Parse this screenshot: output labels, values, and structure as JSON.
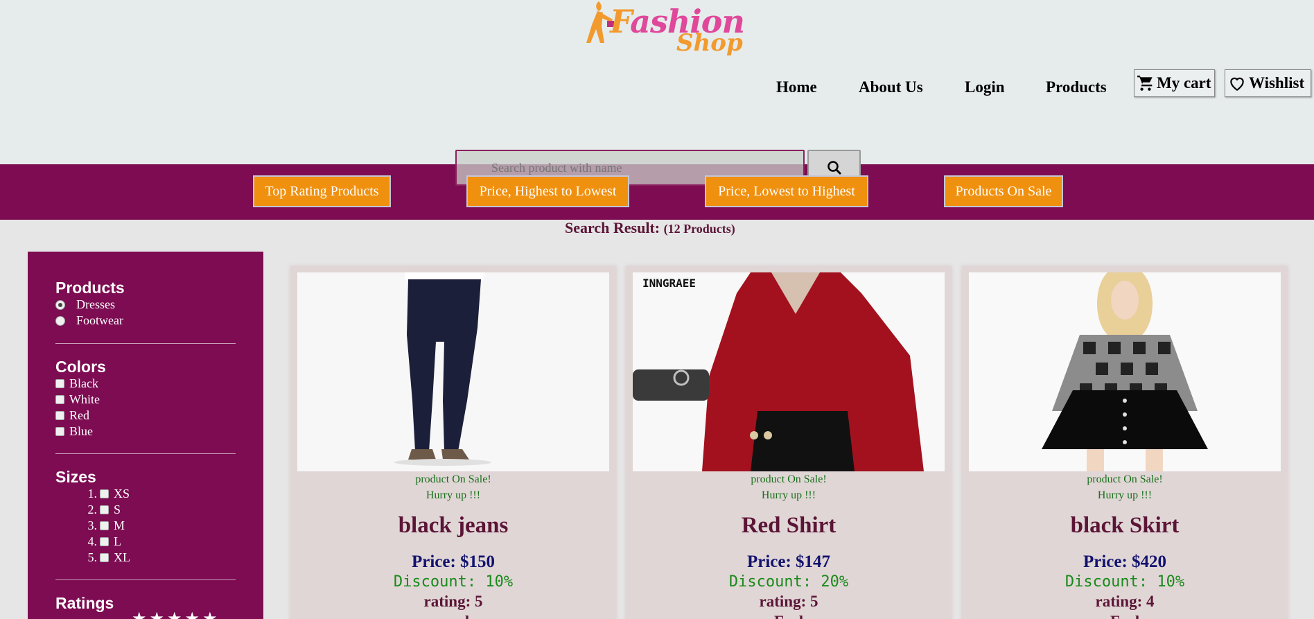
{
  "brand": {
    "logo_main": "ashion",
    "logo_f": "F",
    "logo_sub": "Shop"
  },
  "nav": {
    "home": "Home",
    "about": "About Us",
    "login": "Login",
    "products": "Products",
    "cart": "My cart",
    "wishlist": "Wishlist"
  },
  "search": {
    "placeholder": "Search product with name",
    "button_icon": "search-icon"
  },
  "sort_buttons": [
    "Top Rating Products",
    "Price, Highest to Lowest",
    "Price, Lowest to Highest",
    "Products On Sale"
  ],
  "result": {
    "label": "Search Result:",
    "count": "(12 Products)"
  },
  "sidebar": {
    "products_title": "Products",
    "products": [
      {
        "label": "Dresses",
        "selected": true
      },
      {
        "label": "Footwear",
        "selected": false
      }
    ],
    "colors_title": "Colors",
    "colors": [
      "Black",
      "White",
      "Red",
      "Blue"
    ],
    "sizes_title": "Sizes",
    "sizes": [
      {
        "num": "1.",
        "label": "XS"
      },
      {
        "num": "2.",
        "label": "S"
      },
      {
        "num": "3.",
        "label": "M"
      },
      {
        "num": "4.",
        "label": "L"
      },
      {
        "num": "5.",
        "label": "XL"
      }
    ],
    "ratings_title": "Ratings",
    "stars": "★★★★★"
  },
  "products": [
    {
      "sale": "product On Sale!",
      "hurry": "Hurry up !!!",
      "name": "black jeans",
      "price": "Price: $150",
      "discount": "Discount: 10%",
      "rating": "rating: 5",
      "extra": "e... d"
    },
    {
      "sale": "product On Sale!",
      "hurry": "Hurry up !!!",
      "name": "Red Shirt",
      "price": "Price: $147",
      "discount": "Discount: 20%",
      "rating": "rating: 5",
      "extra": "F...d"
    },
    {
      "sale": "product On Sale!",
      "hurry": "Hurry up !!!",
      "name": "black Skirt",
      "price": "Price: $420",
      "discount": "Discount: 10%",
      "rating": "rating: 4",
      "extra": "F...d"
    }
  ],
  "image_text": {
    "brand_watermark": "INNGRAEE"
  },
  "colors": {
    "band": "#7d0c52",
    "sort_button": "#f0900f",
    "header_bg": "#e6ecec"
  }
}
